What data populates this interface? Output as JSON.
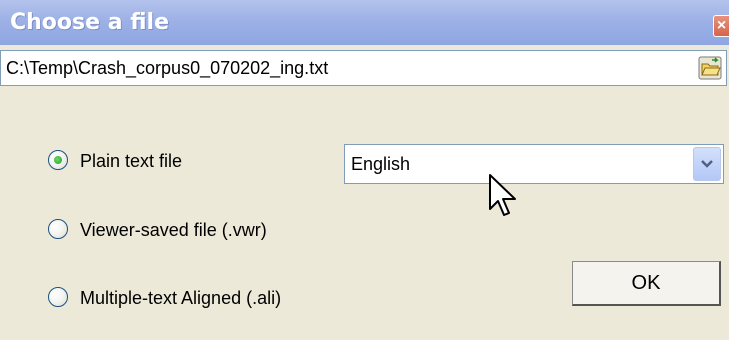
{
  "window": {
    "title": "Choose a file",
    "close_glyph": "×"
  },
  "file_path": {
    "value": "C:\\Temp\\Crash_corpus0_070202_ing.txt",
    "browse_icon": "open-folder-icon"
  },
  "options": [
    {
      "label": "Plain text file",
      "selected": true
    },
    {
      "label": "Viewer-saved file (.vwr)",
      "selected": false
    },
    {
      "label": "Multiple-text Aligned (.ali)",
      "selected": false
    }
  ],
  "language_select": {
    "value": "English"
  },
  "ok_button": {
    "label": "OK"
  },
  "colors": {
    "title_bar": "#9db1e6",
    "dialog_bg": "#ece9d8",
    "radio_dot": "#21a121"
  }
}
